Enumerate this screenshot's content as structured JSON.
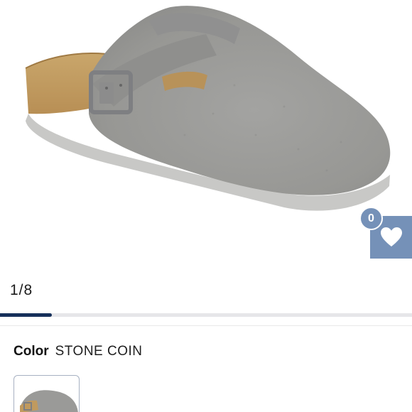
{
  "gallery": {
    "position_text": "1/8",
    "current": 1,
    "total": 8,
    "progress_fraction": 0.125,
    "accent_color": "#16305a"
  },
  "wishlist": {
    "count": "0",
    "icon": "heart-icon",
    "color": "#7591b8"
  },
  "product": {
    "color_label": "Color",
    "color_value": "STONE COIN"
  },
  "swatches": [
    {
      "name": "STONE COIN",
      "selected": true
    }
  ]
}
